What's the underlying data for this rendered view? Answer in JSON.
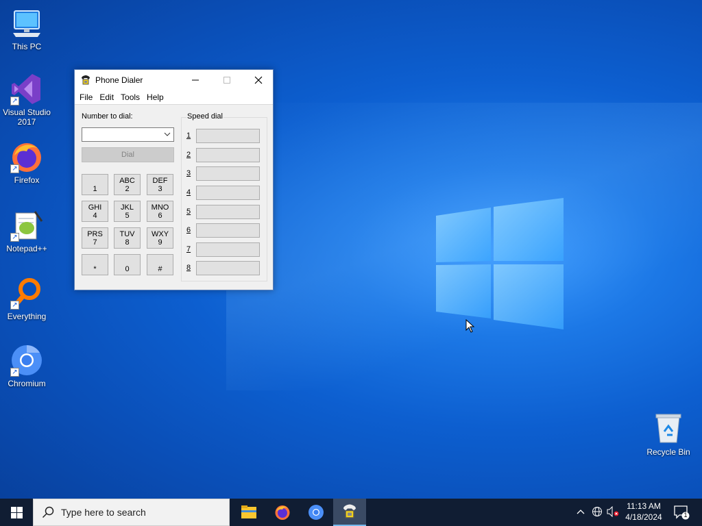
{
  "desktop": {
    "icons": [
      {
        "label": "This PC"
      },
      {
        "label": "Visual Studio 2017"
      },
      {
        "label": "Firefox"
      },
      {
        "label": "Notepad++"
      },
      {
        "label": "Everything"
      },
      {
        "label": "Chromium"
      },
      {
        "label": "Recycle Bin"
      }
    ]
  },
  "window": {
    "title": "Phone Dialer",
    "menu": [
      "File",
      "Edit",
      "Tools",
      "Help"
    ],
    "number_label": "Number to dial:",
    "number_value": "",
    "dial_label": "Dial",
    "keypad": [
      {
        "letters": "",
        "digit": "1"
      },
      {
        "letters": "ABC",
        "digit": "2"
      },
      {
        "letters": "DEF",
        "digit": "3"
      },
      {
        "letters": "GHI",
        "digit": "4"
      },
      {
        "letters": "JKL",
        "digit": "5"
      },
      {
        "letters": "MNO",
        "digit": "6"
      },
      {
        "letters": "PRS",
        "digit": "7"
      },
      {
        "letters": "TUV",
        "digit": "8"
      },
      {
        "letters": "WXY",
        "digit": "9"
      },
      {
        "letters": "",
        "digit": "*"
      },
      {
        "letters": "",
        "digit": "0"
      },
      {
        "letters": "",
        "digit": "#"
      }
    ],
    "speed_dial_title": "Speed dial",
    "speed_dial": [
      "1",
      "2",
      "3",
      "4",
      "5",
      "6",
      "7",
      "8"
    ]
  },
  "taskbar": {
    "search_placeholder": "Type here to search",
    "time": "11:13 AM",
    "date": "4/18/2024",
    "notification_count": "1",
    "apps": [
      "file-explorer-icon",
      "firefox-icon",
      "chromium-icon",
      "phone-dialer-icon"
    ]
  },
  "colors": {
    "taskbar": "#101d33",
    "accent": "#76b9ed",
    "desktop": "#0d5fd0"
  }
}
